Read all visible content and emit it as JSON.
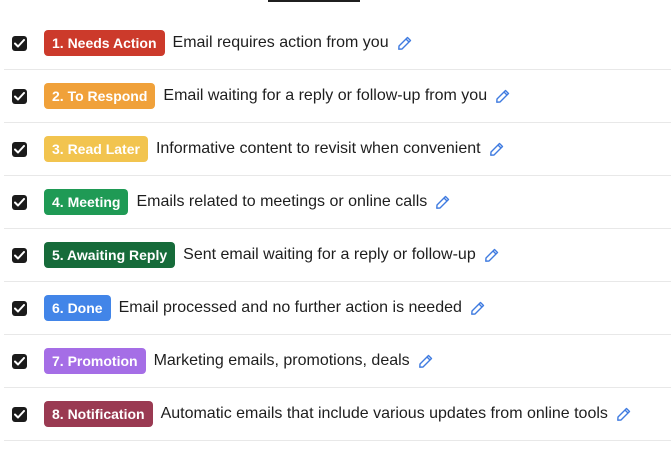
{
  "labels": [
    {
      "badge": "1. Needs Action",
      "description": "Email requires action from you",
      "color": "#cc3a2b",
      "checked": true
    },
    {
      "badge": "2. To Respond",
      "description": "Email waiting for a reply or follow-up from you",
      "color": "#f0a13a",
      "checked": true
    },
    {
      "badge": "3. Read Later",
      "description": "Informative content to revisit when convenient",
      "color": "#f2c44f",
      "checked": true
    },
    {
      "badge": "4. Meeting",
      "description": "Emails related to meetings or online calls",
      "color": "#1f9a55",
      "checked": true
    },
    {
      "badge": "5. Awaiting Reply",
      "description": "Sent email waiting for a reply or follow-up",
      "color": "#166b3a",
      "checked": true
    },
    {
      "badge": "6. Done",
      "description": "Email processed and no further action is needed",
      "color": "#4285e8",
      "checked": true
    },
    {
      "badge": "7. Promotion",
      "description": "Marketing emails, promotions, deals",
      "color": "#a56ee6",
      "checked": true
    },
    {
      "badge": "8. Notification",
      "description": "Automatic emails that include various updates from online tools",
      "color": "#9a3a52",
      "checked": true
    }
  ],
  "icons": {
    "checkbox": "checkmark-icon",
    "edit": "pencil-icon"
  },
  "colors": {
    "edit_icon": "#3f7be0",
    "checkbox_fill": "#1b1b1b"
  }
}
